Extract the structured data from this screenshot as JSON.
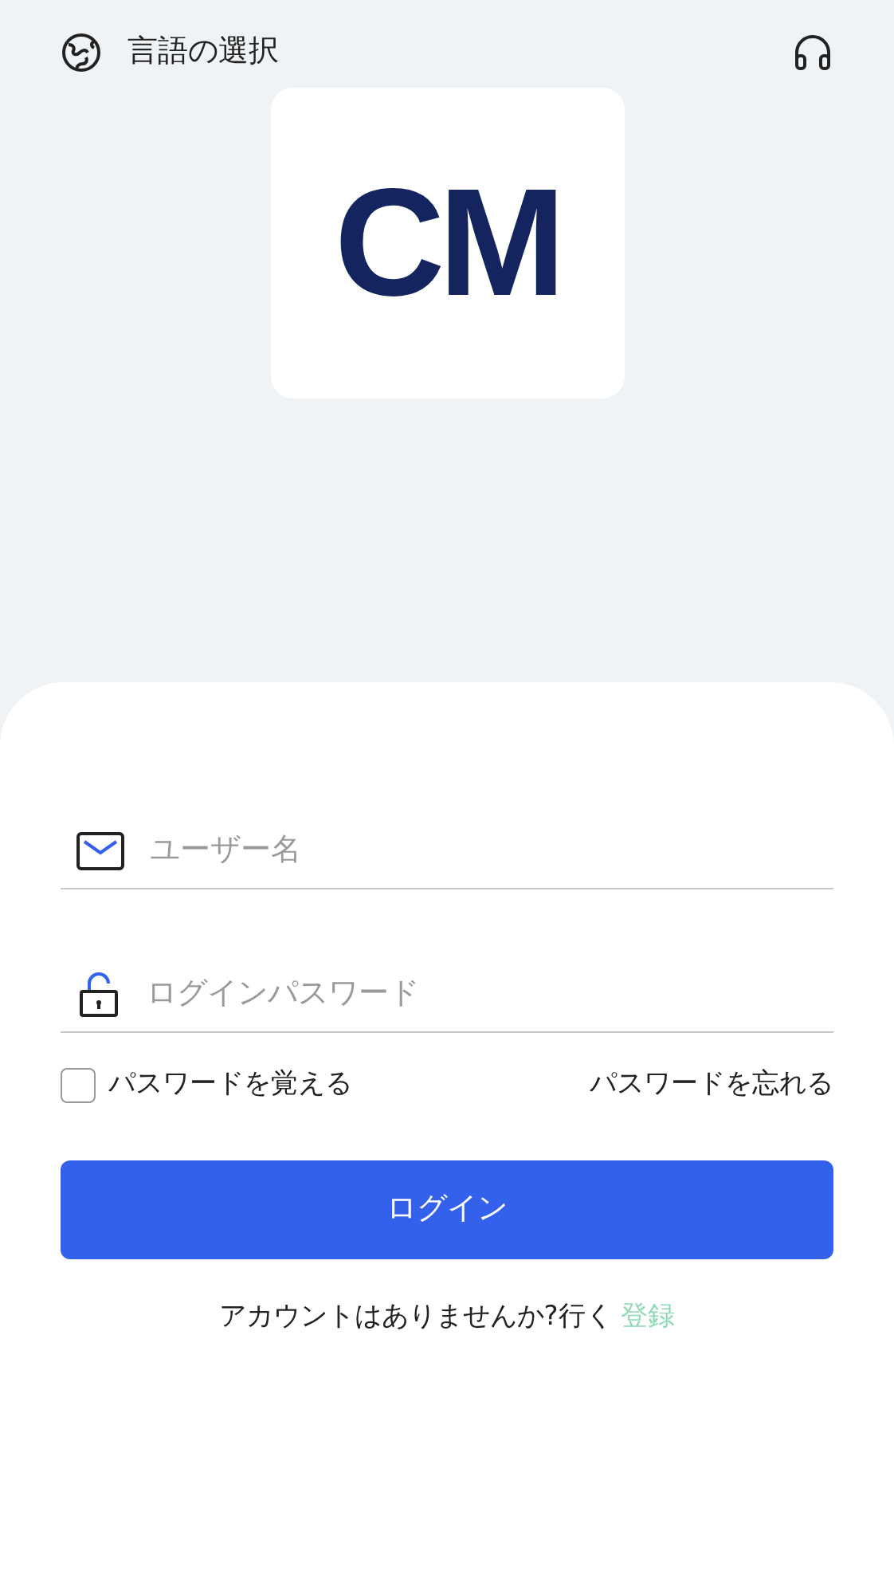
{
  "header": {
    "language_label": "言語の選択"
  },
  "logo": {
    "text": "CM"
  },
  "form": {
    "username": {
      "placeholder": "ユーザー名"
    },
    "password": {
      "placeholder": "ログインパスワード"
    },
    "remember": {
      "label": "パスワードを覚える",
      "checked": false
    },
    "forgot_link": "パスワードを忘れる",
    "login_button": "ログイン",
    "signup_prompt": "アカウントはありませんか?行く",
    "signup_link": "登録"
  }
}
